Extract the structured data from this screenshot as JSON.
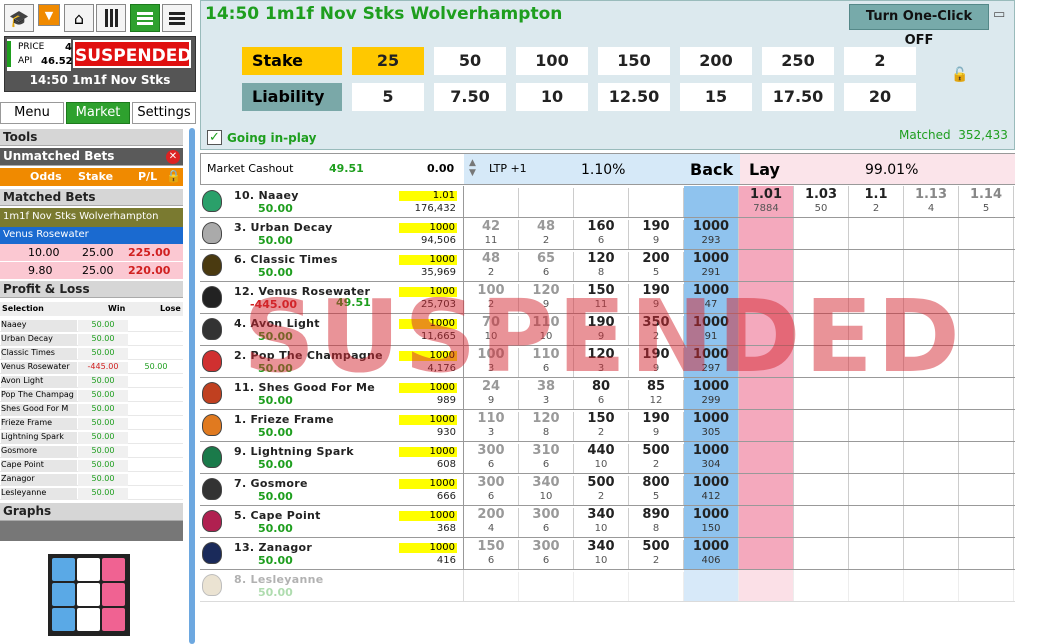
{
  "toolbar": {
    "icons": [
      "graduation-cap-icon",
      "dropdown-icon",
      "home-icon",
      "columns-icon",
      "rows-icon",
      "list-icon"
    ]
  },
  "status": {
    "price_label": "PRICE",
    "price_value": "4",
    "api_label": "API",
    "api_value": "46.52",
    "suspended": "SUSPENDED",
    "race": "14:50 1m1f Nov Stks"
  },
  "nav": {
    "menu": "Menu",
    "market": "Market",
    "settings": "Settings"
  },
  "left": {
    "tools": "Tools",
    "unmatched": "Unmatched Bets",
    "odds": "Odds",
    "stake": "Stake",
    "pl": "P/L",
    "matched": "Matched Bets",
    "race_title": "1m1f Nov Stks Wolverhampton",
    "selection": "Venus Rosewater",
    "bets": [
      {
        "odds": "10.00",
        "stake": "25.00",
        "pl": "225.00"
      },
      {
        "odds": "9.80",
        "stake": "25.00",
        "pl": "220.00"
      }
    ],
    "profit_loss": "Profit & Loss",
    "col_sel": "Selection",
    "col_win": "Win",
    "col_lose": "Lose",
    "pl_rows": [
      {
        "name": "Naaey",
        "win": "50.00",
        "lose": ""
      },
      {
        "name": "Urban Decay",
        "win": "50.00",
        "lose": ""
      },
      {
        "name": "Classic Times",
        "win": "50.00",
        "lose": ""
      },
      {
        "name": "Venus Rosewater",
        "win": "-445.00",
        "lose": "50.00"
      },
      {
        "name": "Avon Light",
        "win": "50.00",
        "lose": ""
      },
      {
        "name": "Pop The Champag",
        "win": "50.00",
        "lose": ""
      },
      {
        "name": "Shes Good For M",
        "win": "50.00",
        "lose": ""
      },
      {
        "name": "Frieze Frame",
        "win": "50.00",
        "lose": ""
      },
      {
        "name": "Lightning Spark",
        "win": "50.00",
        "lose": ""
      },
      {
        "name": "Gosmore",
        "win": "50.00",
        "lose": ""
      },
      {
        "name": "Cape Point",
        "win": "50.00",
        "lose": ""
      },
      {
        "name": "Zanagor",
        "win": "50.00",
        "lose": ""
      },
      {
        "name": "Lesleyanne",
        "win": "50.00",
        "lose": ""
      }
    ],
    "graphs": "Graphs"
  },
  "top": {
    "title": "14:50 1m1f Nov Stks Wolverhampton",
    "one_click": "Turn One-Click OFF",
    "stake_label": "Stake",
    "liability_label": "Liability",
    "stakes": [
      "25",
      "50",
      "100",
      "150",
      "200",
      "250",
      "2"
    ],
    "liabilities": [
      "5",
      "7.50",
      "10",
      "12.50",
      "15",
      "17.50",
      "20"
    ],
    "inplay": "Going in-play",
    "matched_label": "Matched",
    "matched_value": "352,433"
  },
  "market": {
    "cashout_label": "Market Cashout",
    "cashout_value": "49.51",
    "cashout_zero": "0.00",
    "ltp": "LTP +1",
    "back_pct": "1.10%",
    "back": "Back",
    "lay": "Lay",
    "lay_pct": "99.01%",
    "overlay": "SUSPENDED"
  },
  "runners": [
    {
      "name": "10. Naaey",
      "pl": "50.00",
      "pl2": "",
      "ltp": "1.01",
      "vol": "176,432",
      "b": [
        [
          "",
          ""
        ],
        [
          "",
          ""
        ],
        [
          "",
          ""
        ],
        [
          "",
          ""
        ]
      ],
      "bb": [
        "",
        ""
      ],
      "l": [
        [
          "1.01",
          "7884"
        ],
        [
          "1.03",
          "50"
        ],
        [
          "1.1",
          "2"
        ],
        [
          "1.13",
          "4"
        ],
        [
          "1.14",
          "5"
        ]
      ]
    },
    {
      "name": "3. Urban Decay",
      "pl": "50.00",
      "pl2": "",
      "ltp": "1000",
      "vol": "94,506",
      "b": [
        [
          "42",
          "11"
        ],
        [
          "48",
          "2"
        ],
        [
          "160",
          "6"
        ],
        [
          "190",
          "9"
        ]
      ],
      "bb": [
        "1000",
        "293"
      ],
      "l": []
    },
    {
      "name": "6. Classic Times",
      "pl": "50.00",
      "pl2": "",
      "ltp": "1000",
      "vol": "35,969",
      "b": [
        [
          "48",
          "2"
        ],
        [
          "65",
          "6"
        ],
        [
          "120",
          "8"
        ],
        [
          "200",
          "5"
        ]
      ],
      "bb": [
        "1000",
        "291"
      ],
      "l": []
    },
    {
      "name": "12. Venus Rosewater",
      "pl": "-445.00",
      "pl2": "49.51",
      "ltp": "1000",
      "vol": "25,703",
      "b": [
        [
          "100",
          "2"
        ],
        [
          "120",
          "9"
        ],
        [
          "150",
          "11"
        ],
        [
          "190",
          "9"
        ]
      ],
      "bb": [
        "1000",
        "47"
      ],
      "l": []
    },
    {
      "name": "4. Avon Light",
      "pl": "50.00",
      "pl2": "",
      "ltp": "1000",
      "vol": "11,665",
      "b": [
        [
          "70",
          "10"
        ],
        [
          "110",
          "10"
        ],
        [
          "190",
          "9"
        ],
        [
          "350",
          "2"
        ]
      ],
      "bb": [
        "1000",
        "91"
      ],
      "l": []
    },
    {
      "name": "2. Pop The Champagne",
      "pl": "50.00",
      "pl2": "",
      "ltp": "1000",
      "vol": "4,176",
      "b": [
        [
          "100",
          "3"
        ],
        [
          "110",
          "6"
        ],
        [
          "120",
          "3"
        ],
        [
          "190",
          "9"
        ]
      ],
      "bb": [
        "1000",
        "297"
      ],
      "l": []
    },
    {
      "name": "11. Shes Good For Me",
      "pl": "50.00",
      "pl2": "",
      "ltp": "1000",
      "vol": "989",
      "b": [
        [
          "24",
          "9"
        ],
        [
          "38",
          "3"
        ],
        [
          "80",
          "6"
        ],
        [
          "85",
          "12"
        ]
      ],
      "bb": [
        "1000",
        "299"
      ],
      "l": []
    },
    {
      "name": "1. Frieze Frame",
      "pl": "50.00",
      "pl2": "",
      "ltp": "1000",
      "vol": "930",
      "b": [
        [
          "110",
          "3"
        ],
        [
          "120",
          "8"
        ],
        [
          "150",
          "2"
        ],
        [
          "190",
          "9"
        ]
      ],
      "bb": [
        "1000",
        "305"
      ],
      "l": []
    },
    {
      "name": "9. Lightning Spark",
      "pl": "50.00",
      "pl2": "",
      "ltp": "1000",
      "vol": "608",
      "b": [
        [
          "300",
          "6"
        ],
        [
          "310",
          "6"
        ],
        [
          "440",
          "10"
        ],
        [
          "500",
          "2"
        ]
      ],
      "bb": [
        "1000",
        "304"
      ],
      "l": []
    },
    {
      "name": "7. Gosmore",
      "pl": "50.00",
      "pl2": "",
      "ltp": "1000",
      "vol": "666",
      "b": [
        [
          "300",
          "6"
        ],
        [
          "340",
          "10"
        ],
        [
          "500",
          "2"
        ],
        [
          "800",
          "5"
        ]
      ],
      "bb": [
        "1000",
        "412"
      ],
      "l": []
    },
    {
      "name": "5. Cape Point",
      "pl": "50.00",
      "pl2": "",
      "ltp": "1000",
      "vol": "368",
      "b": [
        [
          "200",
          "4"
        ],
        [
          "300",
          "6"
        ],
        [
          "340",
          "10"
        ],
        [
          "890",
          "8"
        ]
      ],
      "bb": [
        "1000",
        "150"
      ],
      "l": []
    },
    {
      "name": "13. Zanagor",
      "pl": "50.00",
      "pl2": "",
      "ltp": "1000",
      "vol": "416",
      "b": [
        [
          "150",
          "6"
        ],
        [
          "300",
          "6"
        ],
        [
          "340",
          "10"
        ],
        [
          "500",
          "2"
        ]
      ],
      "bb": [
        "1000",
        "406"
      ],
      "l": []
    },
    {
      "name": "8. Lesleyanne",
      "pl": "50.00",
      "pl2": "",
      "ltp": "",
      "vol": "",
      "b": [
        [
          "",
          ""
        ],
        [
          "",
          ""
        ],
        [
          "",
          ""
        ],
        [
          "",
          ""
        ]
      ],
      "bb": [
        "",
        ""
      ],
      "l": [],
      "removed": true
    }
  ],
  "silk_colors": [
    "#2aa06a",
    "#aaaaaa",
    "#4a3a10",
    "#222222",
    "#333333",
    "#d03030",
    "#c04020",
    "#e07a20",
    "#1a7a4a",
    "#333333",
    "#b02050",
    "#1a2a5a",
    "#c8b080"
  ],
  "logo_colors": [
    "#5aa9e6",
    "#ffffff",
    "#f06292"
  ]
}
